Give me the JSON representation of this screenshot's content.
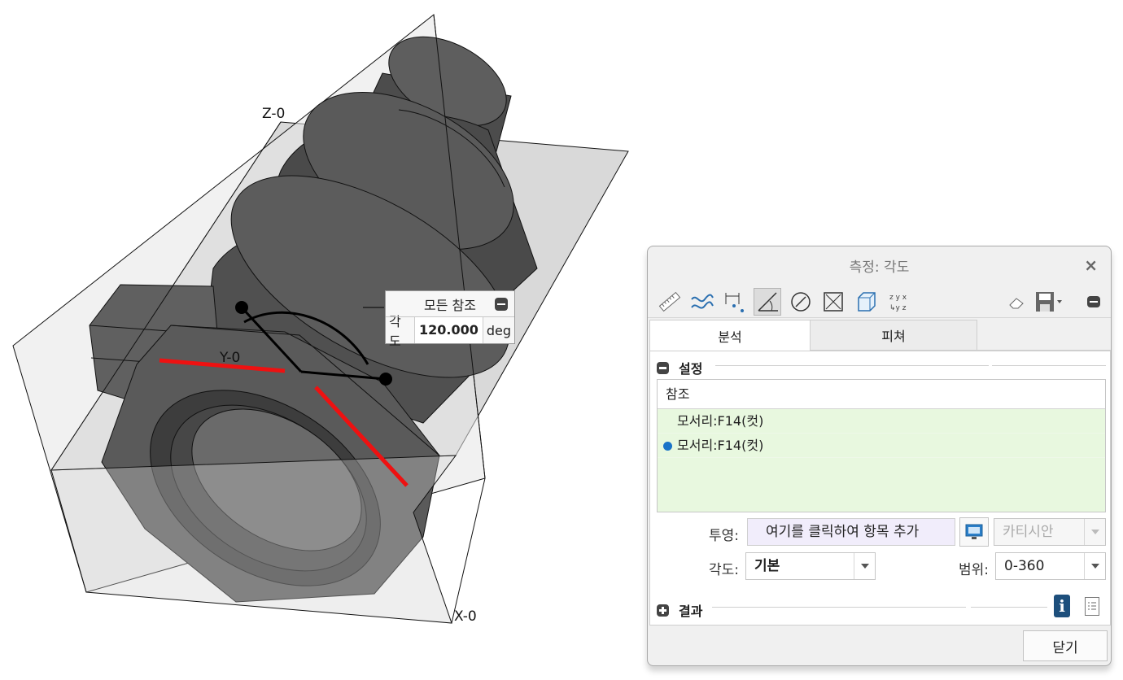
{
  "viewport": {
    "plane_labels": {
      "z": "Z-0",
      "y": "Y-0",
      "x": "X-0"
    },
    "callout": {
      "header": "모든 참조",
      "label": "각도",
      "value": "120.000",
      "unit": "deg"
    }
  },
  "dialog": {
    "title": "측정: 각도",
    "toolbar": {
      "tools": [
        "ruler-icon",
        "curve-length-icon",
        "distance-icon",
        "angle-icon",
        "diameter-icon",
        "area-icon",
        "volume-icon",
        "transform-icon"
      ],
      "active_tool": "angle-icon",
      "right_tools": [
        "eraser-icon",
        "save-icon",
        "collapse-icon"
      ]
    },
    "tabs": [
      {
        "label": "분석",
        "active": true
      },
      {
        "label": "피쳐",
        "active": false
      }
    ],
    "settings": {
      "section_label": "설정",
      "references": {
        "header": "참조",
        "items": [
          {
            "label": "모서리:F14(컷)",
            "active": false
          },
          {
            "label": "모서리:F14(컷)",
            "active": true
          }
        ]
      },
      "projection": {
        "label": "투영:",
        "placeholder": "여기를 클릭하여 항목 추가",
        "system": "카티시안"
      },
      "angle": {
        "label": "각도:",
        "value": "기본"
      },
      "range": {
        "label": "범위:",
        "value": "0-360"
      }
    },
    "results": {
      "section_label": "결과"
    },
    "close_label": "닫기"
  }
}
